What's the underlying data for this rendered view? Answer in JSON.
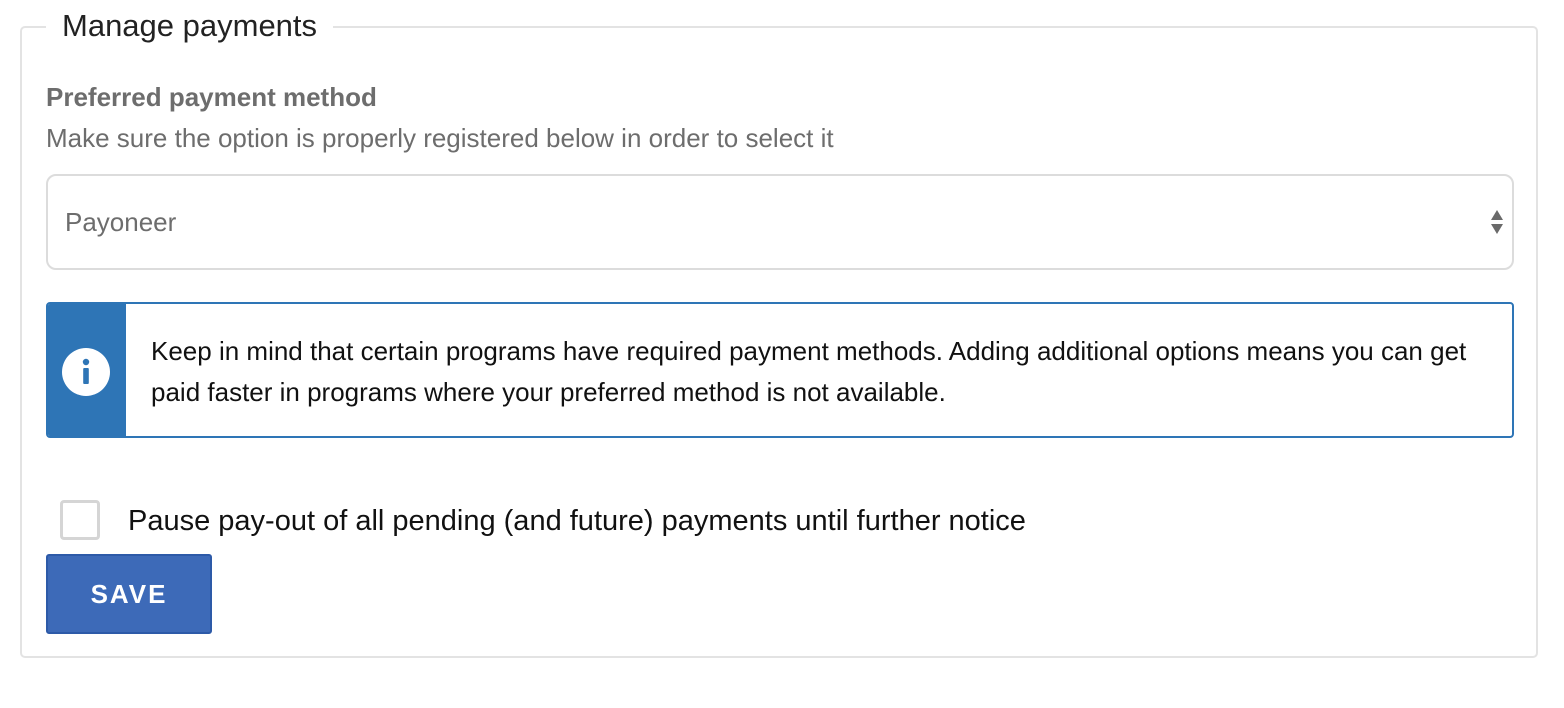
{
  "fieldset": {
    "legend": "Manage payments"
  },
  "preferred_method": {
    "label": "Preferred payment method",
    "help": "Make sure the option is properly registered below in order to select it",
    "selected_value": "Payoneer"
  },
  "info_box": {
    "icon": "info-icon",
    "text": "Keep in mind that certain programs have required payment methods. Adding additional options means you can get paid faster in programs where your preferred method is not available."
  },
  "pause_payout": {
    "checked": false,
    "label": "Pause pay-out of all pending (and future) payments until further notice"
  },
  "save_button": {
    "label": "SAVE"
  },
  "colors": {
    "accent": "#2e75b6",
    "button": "#3d6ab8",
    "muted_text": "#6d6d6d",
    "border": "#e3e3e3"
  }
}
